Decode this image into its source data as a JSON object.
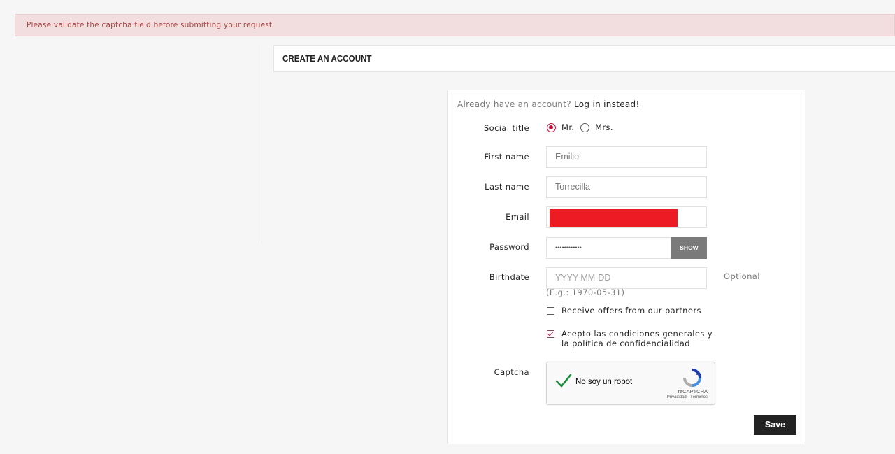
{
  "alert": {
    "message": "Please validate the captcha field before submitting your request"
  },
  "header": {
    "title": "CREATE AN ACCOUNT"
  },
  "form": {
    "already_prefix": "Already have an account?",
    "login_link": "Log in instead!",
    "social_title": {
      "label": "Social title",
      "options": [
        "Mr.",
        "Mrs."
      ],
      "selected": "Mr."
    },
    "first_name": {
      "label": "First name",
      "value": "Emilio"
    },
    "last_name": {
      "label": "Last name",
      "value": "Torrecilla"
    },
    "email": {
      "label": "Email",
      "value": ""
    },
    "password": {
      "label": "Password",
      "value": "••••••••••••",
      "show_label": "SHOW"
    },
    "birthdate": {
      "label": "Birthdate",
      "placeholder": "YYYY-MM-DD",
      "optional_label": "Optional",
      "hint": "(E.g.: 1970-05-31)"
    },
    "offers": {
      "label": "Receive offers from our partners",
      "checked": false
    },
    "terms": {
      "label_line1": "Acepto las condiciones generales y",
      "label_line2": "la política de confidencialidad",
      "checked": true
    },
    "captcha": {
      "label": "Captcha",
      "widget_text": "No soy un robot",
      "brand": "reCAPTCHA",
      "links": "Privacidad - Términos",
      "verified": true
    },
    "save_label": "Save"
  },
  "colors": {
    "accent": "#c4103a",
    "alert_bg": "#f2dede",
    "alert_text": "#a94442",
    "redaction": "#ed1c24",
    "save_bg": "#232323",
    "show_bg": "#7a7a7a"
  }
}
